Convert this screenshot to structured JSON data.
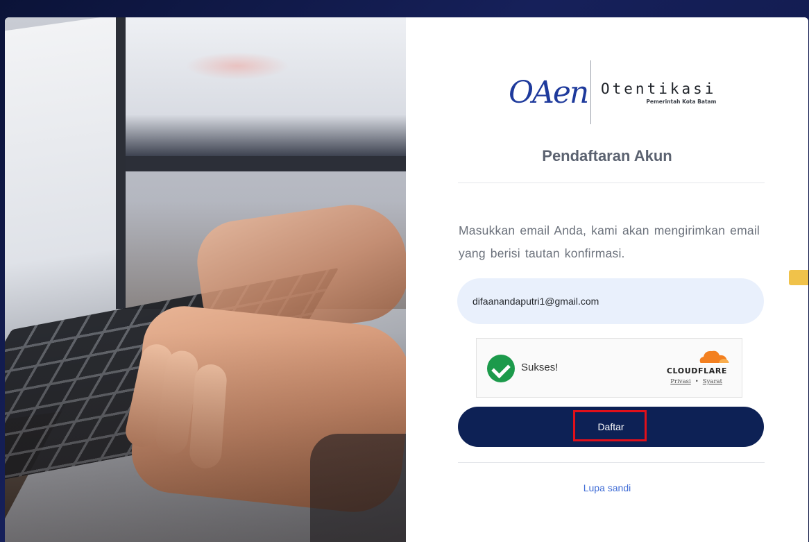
{
  "logo": {
    "script": "OAen",
    "title": "Otentikasi",
    "subtitle": "Pemerintah Kota Batam"
  },
  "form": {
    "heading": "Pendaftaran Akun",
    "description": "Masukkan email Anda, kami akan mengirimkan email yang berisi tautan konfirmasi.",
    "email_value": "difaanandaputri1@gmail.com",
    "captcha": {
      "status": "Sukses!",
      "brand": "CLOUDFLARE",
      "privacy_link": "Privasi",
      "terms_link": "Syarat"
    },
    "submit_label": "Daftar",
    "forgot_link": "Lupa sandi"
  },
  "colors": {
    "button": "#0d2155",
    "input_bg": "#e9f0fc",
    "success": "#1c9a4b",
    "highlight": "#e0101a",
    "link": "#3f6cd6",
    "cloudflare": "#f38020"
  },
  "icons": {
    "captcha_status": "check-circle-icon",
    "cloudflare": "cloudflare-cloud-icon"
  }
}
